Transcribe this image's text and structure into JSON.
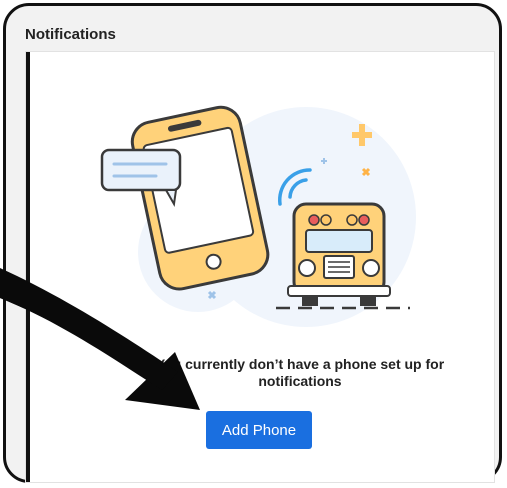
{
  "panel": {
    "title": "Notifications"
  },
  "empty_state": {
    "message_line1": "You currently don’t have a phone set up for",
    "message_line2": "notifications"
  },
  "actions": {
    "add_phone_label": "Add Phone"
  },
  "colors": {
    "accent": "#1a6fe0",
    "phone": "#ffd27a",
    "bus": "#ffd27a",
    "bubble": "#eaf2fb"
  },
  "icons": [
    "phone-illustration",
    "chat-bubble-icon",
    "signal-icon",
    "school-bus-illustration",
    "sparkle-icon",
    "annotation-arrow"
  ]
}
